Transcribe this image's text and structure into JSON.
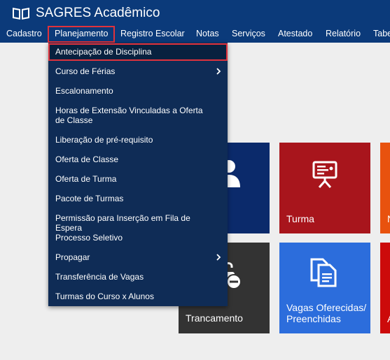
{
  "app": {
    "title": "SAGRES Acadêmico"
  },
  "menu": {
    "items": [
      {
        "label": "Cadastro"
      },
      {
        "label": "Planejamento"
      },
      {
        "label": "Registro Escolar"
      },
      {
        "label": "Notas"
      },
      {
        "label": "Serviços"
      },
      {
        "label": "Atestado"
      },
      {
        "label": "Relatório"
      },
      {
        "label": "Tabe"
      }
    ]
  },
  "dropdown": {
    "items": [
      {
        "label": "Antecipação de Disciplina"
      },
      {
        "label": "Curso de Férias"
      },
      {
        "label": "Escalonamento"
      },
      {
        "label": "Horas de Extensão Vinculadas a Oferta de Classe"
      },
      {
        "label": "Liberação de pré-requisito"
      },
      {
        "label": "Oferta de Classe"
      },
      {
        "label": "Oferta de Turma"
      },
      {
        "label": "Pacote de Turmas"
      },
      {
        "label": "Permissão para Inserção em Fila de Espera"
      },
      {
        "label": "Processo Seletivo"
      },
      {
        "label": "Propagar"
      },
      {
        "label": "Transferência de Vagas"
      },
      {
        "label": "Turmas do Curso x Alunos"
      }
    ]
  },
  "tiles": {
    "turma": {
      "label": "Turma"
    },
    "trancamento": {
      "label": "Trancamento"
    },
    "vagas": {
      "line1": "Vagas Oferecidas/",
      "line2": "Preenchidas"
    },
    "partial_orange": {
      "label": "N"
    },
    "partial_red": {
      "label": "A"
    }
  },
  "colors": {
    "header": "#0b3a7a",
    "dropdown": "#0f2c56",
    "highlight_border": "#e0323c",
    "tile_navy": "#0b2a6b",
    "tile_red": "#a8151c",
    "tile_orange": "#e8520e",
    "tile_dark": "#333333",
    "tile_blue": "#2c6ddc",
    "tile_red2": "#cc0a0a"
  }
}
